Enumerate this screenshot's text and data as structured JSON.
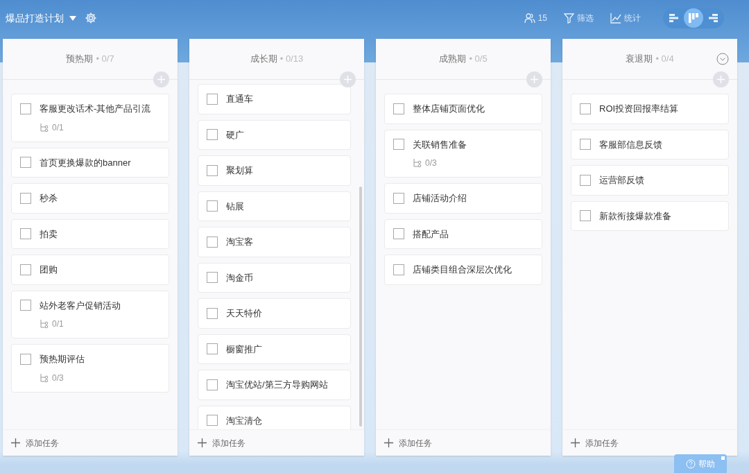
{
  "project": {
    "title": "爆品打造计划"
  },
  "toolbar": {
    "members": "15",
    "filter": "筛选",
    "stats": "统计"
  },
  "views": [
    {
      "kind": "left",
      "selected": false
    },
    {
      "kind": "board",
      "selected": true
    },
    {
      "kind": "right",
      "selected": false
    }
  ],
  "columns": [
    {
      "title": "预热期",
      "count": "• 0/7",
      "scrollable": false,
      "collapse_icon": false,
      "add_label": "添加任务",
      "tasks": [
        {
          "title": "客服更改话术-其他产品引流",
          "checked": false,
          "subtasks": "0/1"
        },
        {
          "title": "首页更换爆款的banner",
          "checked": false
        },
        {
          "title": "秒杀",
          "checked": false
        },
        {
          "title": "拍卖",
          "checked": false
        },
        {
          "title": "团购",
          "checked": false
        },
        {
          "title": "站外老客户促销活动",
          "checked": false,
          "subtasks": "0/1"
        },
        {
          "title": "预热期评估",
          "checked": false,
          "subtasks": "0/3"
        }
      ]
    },
    {
      "title": "成长期",
      "count": "• 0/13",
      "scrollable": true,
      "collapse_icon": false,
      "add_label": "添加任务",
      "tasks": [
        {
          "title": "直通车",
          "checked": false
        },
        {
          "title": "硬广",
          "checked": false
        },
        {
          "title": "聚划算",
          "checked": false
        },
        {
          "title": "钻展",
          "checked": false
        },
        {
          "title": "淘宝客",
          "checked": false
        },
        {
          "title": "淘金币",
          "checked": false
        },
        {
          "title": "天天特价",
          "checked": false
        },
        {
          "title": "橱窗推广",
          "checked": false
        },
        {
          "title": "淘宝优站/第三方导购网站",
          "checked": false
        },
        {
          "title": "淘宝清仓",
          "checked": false
        }
      ]
    },
    {
      "title": "成熟期",
      "count": "• 0/5",
      "scrollable": false,
      "collapse_icon": false,
      "add_label": "添加任务",
      "tasks": [
        {
          "title": "整体店铺页面优化",
          "checked": false
        },
        {
          "title": "关联销售准备",
          "checked": false,
          "subtasks": "0/3"
        },
        {
          "title": "店铺活动介绍",
          "checked": false
        },
        {
          "title": "搭配产品",
          "checked": false
        },
        {
          "title": "店铺类目组合深层次优化",
          "checked": false
        }
      ]
    },
    {
      "title": "衰退期",
      "count": "• 0/4",
      "scrollable": false,
      "collapse_icon": true,
      "add_label": "添加任务",
      "tasks": [
        {
          "title": "ROI投资回报率结算",
          "checked": false
        },
        {
          "title": "客服部信息反馈",
          "checked": false
        },
        {
          "title": "运营部反馈",
          "checked": false
        },
        {
          "title": "新款衔接爆款准备",
          "checked": false
        }
      ]
    }
  ],
  "help": {
    "label": "帮助",
    "notification": true
  }
}
